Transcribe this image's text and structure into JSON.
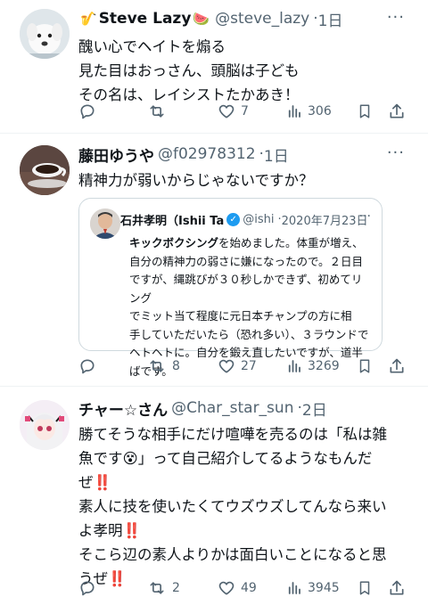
{
  "tweets": [
    {
      "name": "Steve Lazy",
      "name_prefix_emoji": "🎷",
      "name_suffix_emoji": "🍉",
      "handle": "@steve_lazy",
      "time": "1日",
      "lines": [
        "醜い心でヘイトを煽る",
        "見た目はおっさん、頭脳は子ども",
        "その名は、レイシストたかあき！"
      ],
      "reply_count": "",
      "retweet_count": "",
      "like_count": "7",
      "view_count": "306"
    },
    {
      "name": "藤田ゆうや",
      "handle": "@f02978312",
      "time": "1日",
      "lines": [
        "精神力が弱いからじゃないですか？"
      ],
      "reply_count": "",
      "retweet_count": "8",
      "like_count": "27",
      "view_count": "3269",
      "quote": {
        "name": "石井孝明（Ishii Ta",
        "handle": "@ishi",
        "date": "2020年7月23日",
        "bold_lead": "キックボクシング",
        "lines": [
          "を始めました。体重が増え、",
          "自分の精神力の弱さに嫌になったので。２日目",
          "ですが、縄跳びが３０秒しかできず、初めてリング",
          "でミット当て程度に元日本チャンプの方に相",
          "手していただいたら（恐れ多い）、３ラウンドで",
          "ヘトヘトに。自分を鍛え直したいですが、道半",
          "ばです。"
        ]
      }
    },
    {
      "name": "チャー☆さん",
      "handle": "@Char_star_sun",
      "time": "2日",
      "lines": [
        "勝てそうな相手にだけ喧嘩を売るのは「私は雑",
        "魚です",
        "」って自己紹介してるようなもんだ",
        "ぜ",
        "素人に技を使いたくてウズウズしてんなら来い",
        "よ孝明",
        "そこら辺の素人よりかは面白いことになると思",
        "うぜ"
      ],
      "dizzy_emoji": "😵",
      "bang": "‼️",
      "reply_count": "",
      "retweet_count": "2",
      "like_count": "49",
      "view_count": "3945"
    }
  ],
  "more_label": "···"
}
